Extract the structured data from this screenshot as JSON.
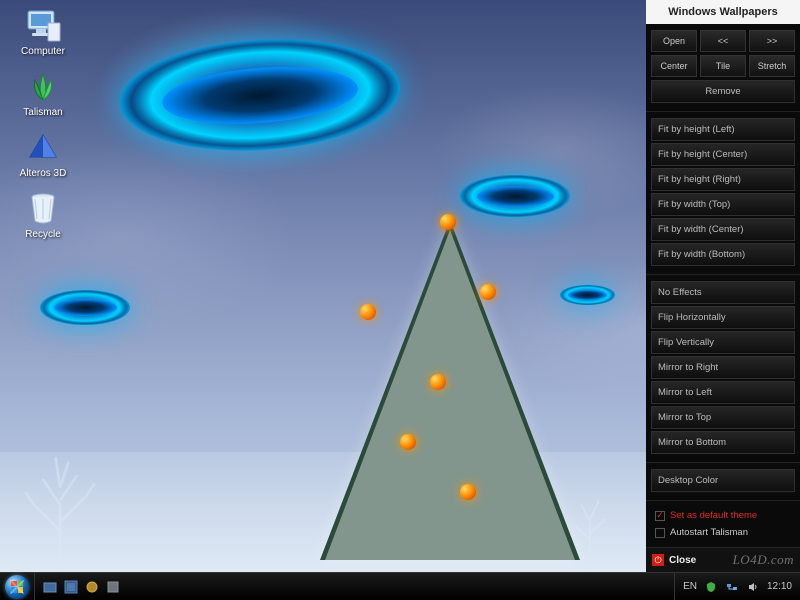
{
  "desktop": {
    "icons": [
      {
        "name": "computer",
        "label": "Computer"
      },
      {
        "name": "talisman",
        "label": "Talisman"
      },
      {
        "name": "alteros3d",
        "label": "Alteros 3D"
      },
      {
        "name": "recycle",
        "label": "Recycle"
      }
    ]
  },
  "panel": {
    "title": "Windows Wallpapers",
    "top_buttons": {
      "open": "Open",
      "prev": "<<",
      "next": ">>",
      "center": "Center",
      "tile": "Tile",
      "stretch": "Stretch",
      "remove": "Remove"
    },
    "fit_buttons": [
      "Fit by height (Left)",
      "Fit by height (Center)",
      "Fit by height (Right)",
      "Fit by width (Top)",
      "Fit by width (Center)",
      "Fit by width (Bottom)"
    ],
    "effect_buttons": [
      "No Effects",
      "Flip Horizontally",
      "Flip Vertically",
      "Mirror to Right",
      "Mirror to Left",
      "Mirror to Top",
      "Mirror to Bottom"
    ],
    "desktop_color": "Desktop Color",
    "checks": {
      "default_theme": {
        "label": "Set as default theme",
        "checked": true
      },
      "autostart": {
        "label": "Autostart Talisman",
        "checked": false
      }
    },
    "close": "Close"
  },
  "taskbar": {
    "lang": "EN",
    "time": "12:10"
  },
  "watermark": "LO4D.com"
}
